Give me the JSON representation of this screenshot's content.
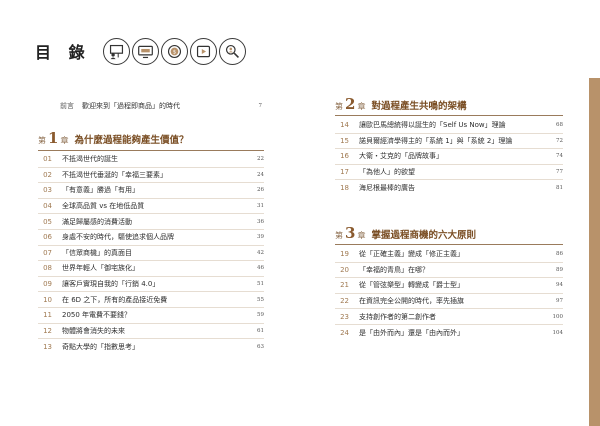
{
  "header": {
    "title": "目 錄"
  },
  "icons": [
    "presenter-icon",
    "monitor-icon",
    "coin-icon",
    "play-icon",
    "magnifier-people-icon"
  ],
  "preface": {
    "label": "前言",
    "text": "歡迎來到「過程即商品」的時代",
    "page": "7"
  },
  "chapters": [
    {
      "prefix": "第",
      "number": "1",
      "suffix": "章",
      "title": "為什麼過程能夠產生價值？",
      "entries": [
        {
          "num": "01",
          "title": "不抵渴世代的誕生",
          "page": "22"
        },
        {
          "num": "02",
          "title": "不抵渴世代垂涎的「幸福三要素」",
          "page": "24"
        },
        {
          "num": "03",
          "title": "「有意義」勝過「有用」",
          "page": "26"
        },
        {
          "num": "04",
          "title": "全球高品質 vs 在地低品質",
          "page": "31"
        },
        {
          "num": "05",
          "title": "滿足歸屬感的消費活動",
          "page": "36"
        },
        {
          "num": "06",
          "title": "身處不安的時代，驅使追求個人品牌",
          "page": "39"
        },
        {
          "num": "07",
          "title": "「信眾商機」的真面目",
          "page": "42"
        },
        {
          "num": "08",
          "title": "世界年輕人「御宅族化」",
          "page": "46"
        },
        {
          "num": "09",
          "title": "讓客戶實現自我的「行銷 4.0」",
          "page": "51"
        },
        {
          "num": "10",
          "title": "在 6D 之下，所有的產品接近免費",
          "page": "55"
        },
        {
          "num": "11",
          "title": "2050 年電費不要錢？",
          "page": "59"
        },
        {
          "num": "12",
          "title": "物體將會消失的未來",
          "page": "61"
        },
        {
          "num": "13",
          "title": "奇點大學的「指數思考」",
          "page": "63"
        }
      ]
    },
    {
      "prefix": "第",
      "number": "2",
      "suffix": "章",
      "title": "對過程產生共鳴的架構",
      "entries": [
        {
          "num": "14",
          "title": "讓歐巴馬總統得以誕生的「Self Us Now」理論",
          "page": "68"
        },
        {
          "num": "15",
          "title": "諾貝爾經濟學得主的「系統 1」與「系統 2」理論",
          "page": "72"
        },
        {
          "num": "16",
          "title": "大衛・艾克的「品牌故事」",
          "page": "74"
        },
        {
          "num": "17",
          "title": "「為他人」的欲望",
          "page": "77"
        },
        {
          "num": "18",
          "title": "海尼根最棒的廣告",
          "page": "81"
        }
      ]
    },
    {
      "prefix": "第",
      "number": "3",
      "suffix": "章",
      "title": "掌握過程商機的六大原則",
      "entries": [
        {
          "num": "19",
          "title": "從「正確主義」變成「修正主義」",
          "page": "86"
        },
        {
          "num": "20",
          "title": "「幸福的青鳥」在哪？",
          "page": "89"
        },
        {
          "num": "21",
          "title": "從「管弦樂型」轉變成「爵士型」",
          "page": "94"
        },
        {
          "num": "22",
          "title": "在資訊完全公開的時代，率先插旗",
          "page": "97"
        },
        {
          "num": "23",
          "title": "支持創作者的第二創作者",
          "page": "100"
        },
        {
          "num": "24",
          "title": "是「由外而內」還是「由內而外」",
          "page": "104"
        }
      ]
    }
  ]
}
